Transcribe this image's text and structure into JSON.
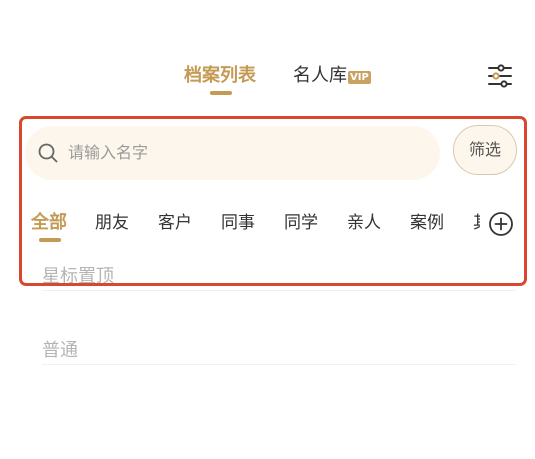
{
  "header": {
    "tabs": [
      {
        "label": "档案列表",
        "active": true
      },
      {
        "label": "名人库",
        "badge": "VIP",
        "active": false
      }
    ],
    "settings_icon": "sliders-icon"
  },
  "search": {
    "placeholder": "请输入名字",
    "icon": "search-icon",
    "filter_button": "筛选"
  },
  "categories": {
    "items": [
      "全部",
      "朋友",
      "客户",
      "同事",
      "同学",
      "亲人",
      "案例",
      "其"
    ],
    "active_index": 0,
    "add_icon": "plus-circle-icon"
  },
  "sections": {
    "starred": "星标置顶",
    "normal": "普通"
  },
  "colors": {
    "accent": "#c49a55",
    "vip_badge": "#c9a163",
    "search_bg": "#fdf6ec",
    "highlight": "#d9482e",
    "section_text": "#b5b5b5"
  }
}
